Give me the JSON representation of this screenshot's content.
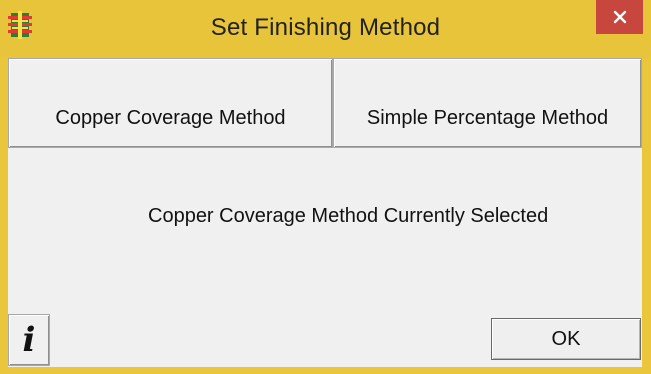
{
  "window": {
    "title": "Set Finishing Method",
    "app_icon": "circuit-board-icon",
    "close_icon": "close-icon"
  },
  "methods": {
    "copper_label": "Copper Coverage Method",
    "simple_label": "Simple Percentage Method"
  },
  "status": {
    "text": "Copper Coverage Method Currently Selected"
  },
  "footer": {
    "info_label": "i",
    "ok_label": "OK"
  },
  "colors": {
    "titlebar": "#e8c43a",
    "close_button": "#c7463d",
    "dialog_background": "#f0f0f0"
  }
}
